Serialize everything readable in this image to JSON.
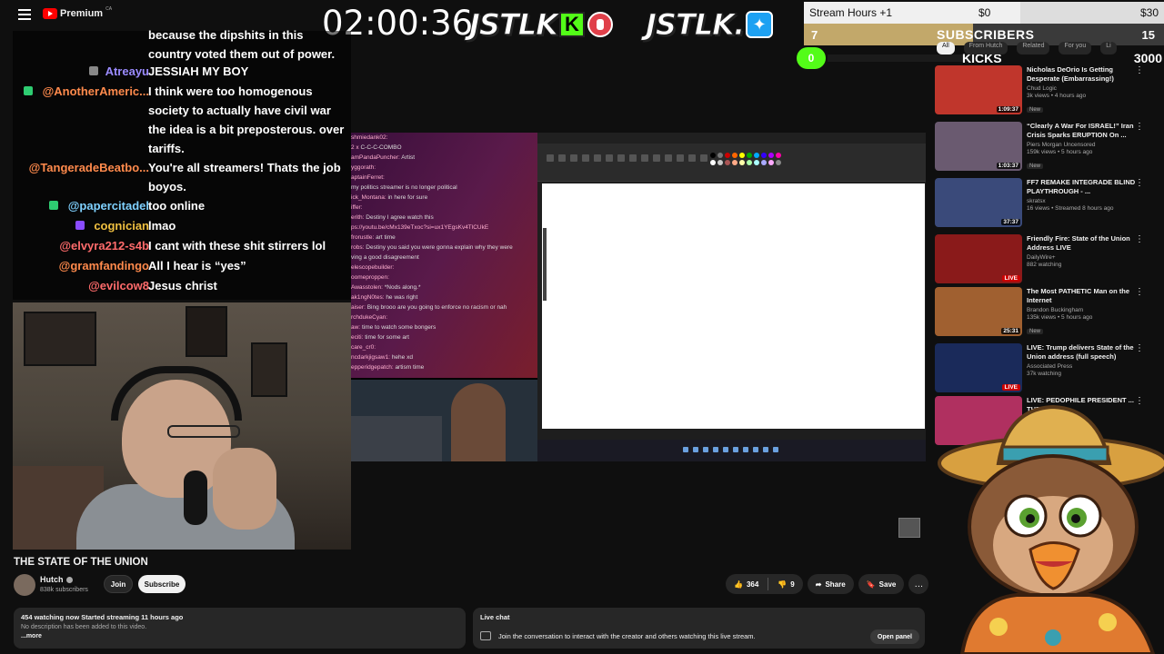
{
  "header": {
    "logo_text": "Premium",
    "region": "CA"
  },
  "overlay": {
    "timer": "02:00:36",
    "brand1": "JSTLK",
    "brand1_badge": "K",
    "brand2": "JSTLK.",
    "goals": {
      "stream_hours": {
        "label": "Stream Hours +1",
        "mid": "$0",
        "end": "$30",
        "progress": 0.6
      },
      "subscribers": {
        "count": "7",
        "label": "SUBSCRIBERS",
        "goal": "15",
        "progress": 0.47
      },
      "kicks": {
        "count": "0",
        "label": "KICKS",
        "goal": "3000",
        "progress": 0.0
      }
    }
  },
  "chat": [
    {
      "user": "",
      "text": "because the dipshits in this country voted them out of power.",
      "color": "#ffffff",
      "badge": ""
    },
    {
      "user": "Atreayu",
      "text": "JESSIAH MY BOY",
      "color": "#9b8bff",
      "badge": "#888"
    },
    {
      "user": "@AnotherAmeric...",
      "text": "I think were too homogenous society to actually have civil war the idea is a bit preposterous. over tariffs.",
      "color": "#ff8a4c",
      "badge": "#2ecc71"
    },
    {
      "user": "@TangeradeBeatbo...",
      "text": "You're all streamers! Thats the job boyos.",
      "color": "#ff8a4c",
      "badge": ""
    },
    {
      "user": "@papercitadel",
      "text": "too online",
      "color": "#7fd1ff",
      "badge": "#2ecc71"
    },
    {
      "user": "cognician",
      "text": "lmao",
      "color": "#f0c040",
      "badge": "#8a4cff"
    },
    {
      "user": "@elvyra212-s4b",
      "text": "I cant with these shit stirrers lol",
      "color": "#ff6b6b",
      "badge": ""
    },
    {
      "user": "@gramfandingo",
      "text": "All I hear is “yes”",
      "color": "#ff8a4c",
      "badge": ""
    },
    {
      "user": "@evilcow8",
      "text": "Jesus christ",
      "color": "#ff6b6b",
      "badge": ""
    }
  ],
  "inner_chat": [
    {
      "u": "shmiedank02:",
      "t": ""
    },
    {
      "u": "2 x",
      "t": "C-C-C-COMBO"
    },
    {
      "u": "amPandaPuncher:",
      "t": "Artist"
    },
    {
      "u": "yggorath:",
      "t": ""
    },
    {
      "u": "aptainFerret:",
      "t": ""
    },
    {
      "u": "",
      "t": "my politics streamer is no longer political"
    },
    {
      "u": "ick_Montana:",
      "t": "in here for sure"
    },
    {
      "u": "iffer:",
      "t": ""
    },
    {
      "u": "erith:",
      "t": "Destiny I agree watch this"
    },
    {
      "u": "ps://youtu.be/cMx139eTxoc?si=ux1YEgsKv4TlCUkE",
      "t": ""
    },
    {
      "u": "frorustle:",
      "t": "art time"
    },
    {
      "u": "robs:",
      "t": "Destiny you said you were gonna explain why they were"
    },
    {
      "u": "",
      "t": "ving a good disagreement"
    },
    {
      "u": "elescopebuilder:",
      "t": ""
    },
    {
      "u": "oomeproppen:",
      "t": ""
    },
    {
      "u": "Awasstolen:",
      "t": "*Nods along.*"
    },
    {
      "u": "ak1ngN0tes:",
      "t": "he was right"
    },
    {
      "u": "aiser:",
      "t": "Bing brooo are you going to enforce no racism or nah"
    },
    {
      "u": "rchdukeCyan:",
      "t": ""
    },
    {
      "u": "aw:",
      "t": "time to watch some bongers"
    },
    {
      "u": "eciti:",
      "t": "time for some art"
    },
    {
      "u": "care_cr0:",
      "t": ""
    },
    {
      "u": "ncdarkjigsaw1:",
      "t": "hehe xd"
    },
    {
      "u": "epperidgepatch:",
      "t": "artism time"
    }
  ],
  "video": {
    "title": "THE STATE OF THE UNION",
    "channel": "Hutch",
    "subscribers": "838k subscribers",
    "join": "Join",
    "subscribe": "Subscribe",
    "likes": "364",
    "dislikes": "9",
    "share": "Share",
    "save": "Save",
    "more": "…"
  },
  "description": {
    "line1": "454 watching now  Started streaming 11 hours ago",
    "line2": "No description has been added to this video.",
    "more": "...more"
  },
  "live_chat": {
    "title": "Live chat",
    "text": "Join the conversation to interact with the creator and others watching this live stream.",
    "open_panel": "Open panel"
  },
  "chips": [
    "All",
    "From Hutch",
    "Related",
    "For you",
    "Li"
  ],
  "related": [
    {
      "title": "Nicholas DeOrio Is Getting Desperate (Embarrassing!)",
      "channel": "Chud Logic",
      "stats": "3k views • 4 hours ago",
      "new": "New",
      "badge": "1:09:37",
      "live": false,
      "thumb": "#c0362c"
    },
    {
      "title": "“Clearly A War For ISRAEL!” Iran Crisis Sparks ERUPTION On ...",
      "channel": "Piers Morgan Uncensored",
      "stats": "159k views • 5 hours ago",
      "new": "New",
      "badge": "1:03:37",
      "live": false,
      "thumb": "#6a5a70"
    },
    {
      "title": "FF7 REMAKE INTEGRADE BLIND PLAYTHROUGH - ...",
      "channel": "skratsx",
      "stats": "16 views • Streamed 8 hours ago",
      "new": "",
      "badge": "37:37",
      "live": false,
      "thumb": "#3a4a7a"
    },
    {
      "title": "Friendly Fire: State of the Union Address LIVE",
      "channel": "DailyWire+",
      "stats": "882 watching",
      "new": "",
      "badge": "LIVE",
      "live": true,
      "thumb": "#8a1a1a"
    },
    {
      "title": "The Most PATHETIC Man on the Internet",
      "channel": "Brandon Buckingham",
      "stats": "135k views • 5 hours ago",
      "new": "New",
      "badge": "25:31",
      "live": false,
      "thumb": "#a06030"
    },
    {
      "title": "LIVE: Trump delivers State of the Union address (full speech)",
      "channel": "Associated Press",
      "stats": "37k watching",
      "new": "",
      "badge": "LIVE",
      "live": true,
      "thumb": "#1a2a5a"
    },
    {
      "title": "LIVE: PEDOPHILE PRESIDENT ... THE UNION ...",
      "channel": "",
      "stats": "",
      "new": "",
      "badge": "",
      "live": false,
      "thumb": "#b03060"
    }
  ],
  "colors": {
    "kick_green": "#53fc18",
    "youtube_red": "#ff0000",
    "twitter_blue": "#1da1f2"
  }
}
